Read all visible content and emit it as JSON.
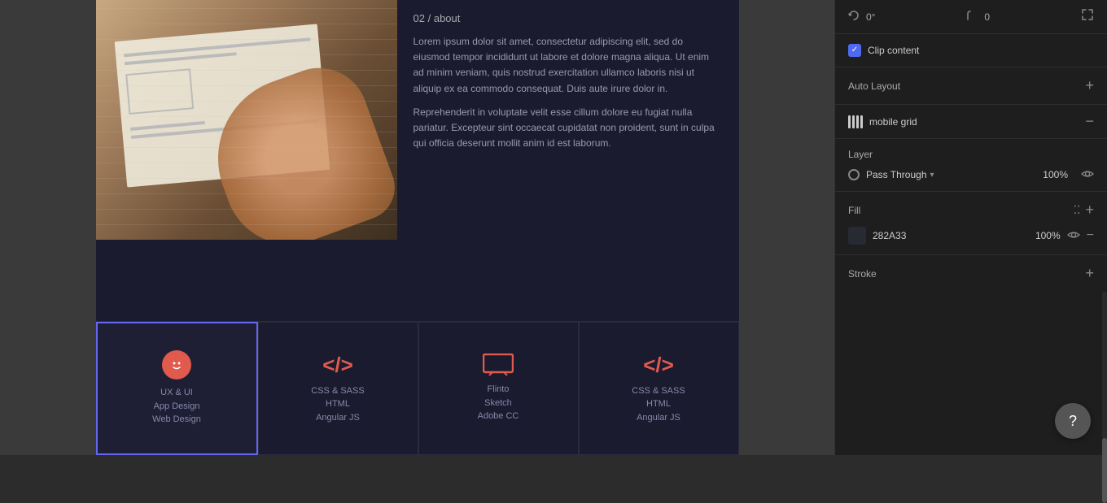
{
  "canvas": {
    "breadcrumb": {
      "number": "02",
      "separator": "/",
      "section": "about"
    },
    "paragraph1": "Lorem ipsum dolor sit amet, consectetur adipiscing elit, sed do eiusmod tempor incididunt ut labore et dolore magna aliqua. Ut enim ad minim veniam, quis nostrud exercitation ullamco laboris nisi ut aliquip ex ea commodo consequat. Duis aute irure dolor in.",
    "paragraph2": "Reprehenderit in voluptate velit esse cillum dolore eu fugiat nulla pariatur. Excepteur sint occaecat cupidatat non proident, sunt in culpa qui officia deserunt mollit anim id est laborum.",
    "cards": [
      {
        "id": "card-1",
        "icon_type": "face",
        "lines": [
          "UX & UI",
          "App Design",
          "Web Design"
        ],
        "selected": true
      },
      {
        "id": "card-2",
        "icon_type": "code",
        "lines": [
          "CSS & SASS",
          "HTML",
          "Angular JS"
        ],
        "selected": false
      },
      {
        "id": "card-3",
        "icon_type": "monitor",
        "lines": [
          "Flinto",
          "Sketch",
          "Adobe CC"
        ],
        "selected": false
      },
      {
        "id": "card-4",
        "icon_type": "code",
        "lines": [
          "CSS & SASS",
          "HTML",
          "Angular JS"
        ],
        "selected": false
      }
    ]
  },
  "rightPanel": {
    "topControls": {
      "rotation": "0°",
      "corners": "0",
      "expandIcon": "⤢"
    },
    "clipContent": {
      "label": "Clip content",
      "checked": true
    },
    "autoLayout": {
      "label": "Auto Layout",
      "addIcon": "+"
    },
    "mobileGrid": {
      "label": "mobile grid",
      "removeIcon": "−"
    },
    "layer": {
      "title": "Layer",
      "blendMode": "Pass Through",
      "opacity": "100%",
      "hasEye": true
    },
    "fill": {
      "title": "Fill",
      "color": "282A33",
      "opacity": "100%"
    },
    "stroke": {
      "title": "Stroke",
      "addIcon": "+"
    }
  },
  "helpButton": "?"
}
